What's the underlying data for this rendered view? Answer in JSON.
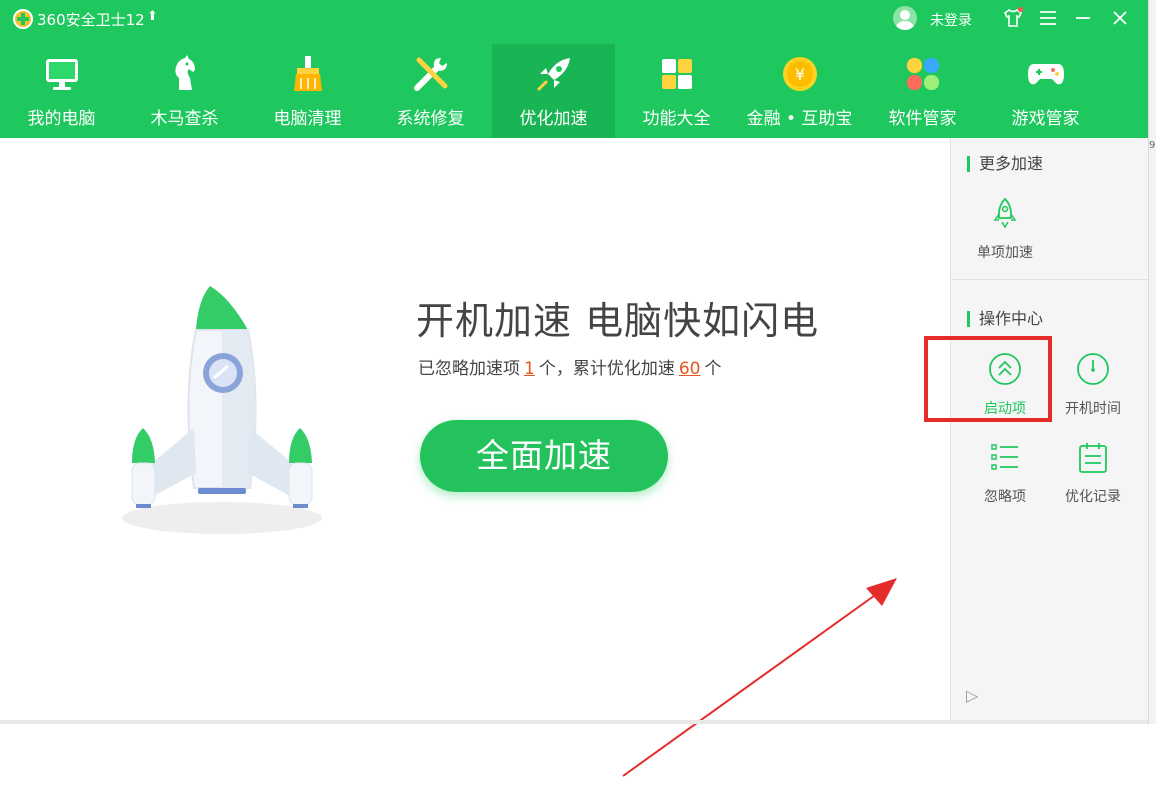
{
  "app": {
    "title": "360安全卫士12",
    "upgrade_icon": "arrow-up-icon",
    "login_text": "未登录"
  },
  "nav": {
    "items": [
      {
        "label": "我的电脑",
        "icon": "monitor-icon"
      },
      {
        "label": "木马查杀",
        "icon": "horse-icon"
      },
      {
        "label": "电脑清理",
        "icon": "broom-icon"
      },
      {
        "label": "系统修复",
        "icon": "wrench-icon"
      },
      {
        "label": "优化加速",
        "icon": "rocket-icon",
        "active": true
      },
      {
        "label": "功能大全",
        "icon": "grid-icon"
      },
      {
        "label": "金融 • 互助宝",
        "icon": "coin-icon"
      },
      {
        "label": "软件管家",
        "icon": "flower-icon"
      },
      {
        "label": "游戏管家",
        "icon": "gamepad-icon"
      }
    ]
  },
  "main": {
    "headline": "开机加速 电脑快如闪电",
    "sub_prefix": "已忽略加速项",
    "ignored_count": "1",
    "sub_middle": "个，累计优化加速",
    "optimized_count": "60",
    "sub_suffix": "个",
    "speedup_button": "全面加速"
  },
  "panel": {
    "more_title": "更多加速",
    "single_speedup": "单项加速",
    "ops_title": "操作中心",
    "startup_items": "启动项",
    "boot_time": "开机时间",
    "ignored_items": "忽略项",
    "optimize_log": "优化记录"
  },
  "edge": {
    "number": "9"
  },
  "colors": {
    "brand_green": "#1ec85e",
    "active_tab": "#19b453",
    "highlight_red": "#e62b2b",
    "count_orange": "#e4561e"
  }
}
